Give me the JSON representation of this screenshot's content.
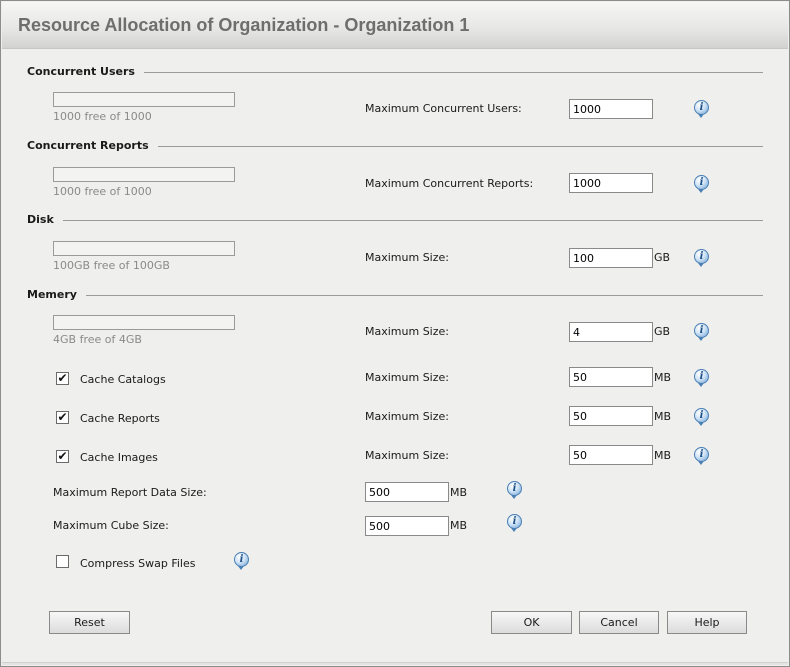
{
  "title": "Resource Allocation of Organization - Organization 1",
  "sections": {
    "concurrent_users": {
      "title": "Concurrent Users",
      "usage_fraction": 0,
      "free_text": "1000 free of 1000",
      "label": "Maximum Concurrent Users:",
      "value": "1000"
    },
    "concurrent_reports": {
      "title": "Concurrent Reports",
      "usage_fraction": 0,
      "free_text": "1000 free of 1000",
      "label": "Maximum Concurrent Reports:",
      "value": "1000"
    },
    "disk": {
      "title": "Disk",
      "usage_fraction": 0,
      "free_text": "100GB free of 100GB",
      "label": "Maximum Size:",
      "value": "100",
      "unit": "GB"
    },
    "memory": {
      "title": "Memery",
      "usage_fraction": 0,
      "free_text": "4GB free of 4GB",
      "label": "Maximum Size:",
      "value": "4",
      "unit": "GB",
      "cache_catalogs": {
        "label": "Cache Catalogs",
        "checked": true,
        "size_label": "Maximum Size:",
        "value": "50",
        "unit": "MB"
      },
      "cache_reports": {
        "label": "Cache Reports",
        "checked": true,
        "size_label": "Maximum Size:",
        "value": "50",
        "unit": "MB"
      },
      "cache_images": {
        "label": "Cache Images",
        "checked": true,
        "size_label": "Maximum Size:",
        "value": "50",
        "unit": "MB"
      },
      "max_report_data": {
        "label": "Maximum Report Data Size:",
        "value": "500",
        "unit": "MB"
      },
      "max_cube": {
        "label": "Maximum Cube Size:",
        "value": "500",
        "unit": "MB"
      },
      "compress_swap": {
        "label": "Compress Swap Files",
        "checked": false
      }
    }
  },
  "info_icon_glyph": "i",
  "check_glyph": "✔",
  "buttons": {
    "reset": "Reset",
    "ok": "OK",
    "cancel": "Cancel",
    "help": "Help"
  }
}
